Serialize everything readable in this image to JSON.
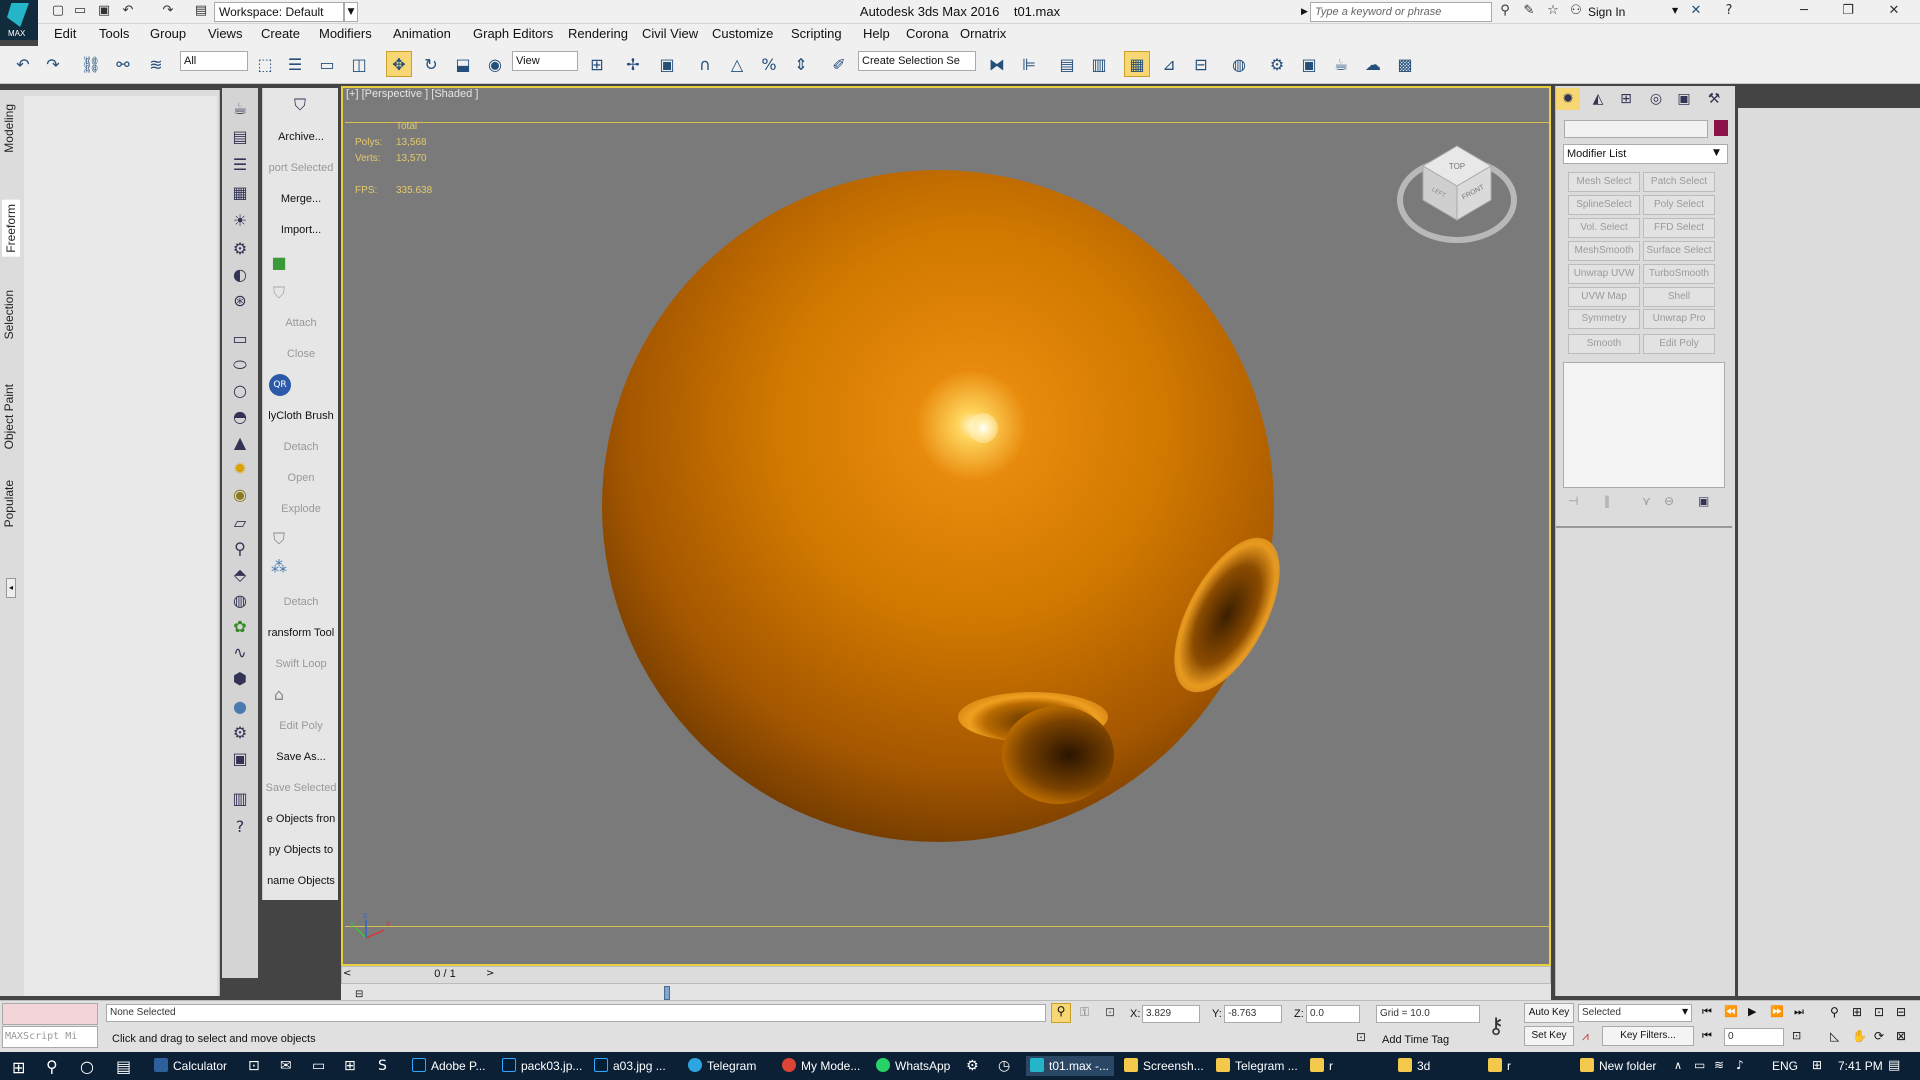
{
  "titlebar": {
    "app_title": "Autodesk 3ds Max 2016",
    "file_name": "t01.max",
    "workspace": "Workspace: Default",
    "search_placeholder": "Type a keyword or phrase",
    "sign_in": "Sign In",
    "logo_text": "MAX"
  },
  "menu": [
    "Edit",
    "Tools",
    "Group",
    "Views",
    "Create",
    "Modifiers",
    "Animation",
    "Graph Editors",
    "Rendering",
    "Civil View",
    "Customize",
    "Scripting",
    "Help",
    "Corona",
    "Ornatrix"
  ],
  "toolbar": {
    "selection_filter": "All",
    "ref_coord": "View",
    "named_selection_placeholder": "Create Selection Se"
  },
  "ribbon_tabs": [
    "Modeling",
    "Freeform",
    "Selection",
    "Object Paint",
    "Populate"
  ],
  "tool_buttons": [
    {
      "label": "Archive...",
      "enabled": true
    },
    {
      "label": "port Selected",
      "enabled": false
    },
    {
      "label": "Merge...",
      "enabled": true
    },
    {
      "label": "Import...",
      "enabled": true
    },
    {
      "label": "Attach",
      "enabled": false
    },
    {
      "label": "Close",
      "enabled": false
    },
    {
      "label": "lyCloth Brush",
      "enabled": true
    },
    {
      "label": "Detach",
      "enabled": false
    },
    {
      "label": "Open",
      "enabled": false
    },
    {
      "label": "Explode",
      "enabled": false
    },
    {
      "label": "Detach",
      "enabled": false
    },
    {
      "label": "ransform Tool",
      "enabled": true
    },
    {
      "label": "Swift Loop",
      "enabled": false
    },
    {
      "label": "Edit Poly",
      "enabled": false
    },
    {
      "label": "Save As...",
      "enabled": true
    },
    {
      "label": "Save Selected",
      "enabled": false
    },
    {
      "label": "e Objects fron",
      "enabled": true
    },
    {
      "label": "py Objects to",
      "enabled": true
    },
    {
      "label": "name Objects",
      "enabled": true
    }
  ],
  "viewport": {
    "label": "[+] [Perspective ] [Shaded ]",
    "stats_header": "Total",
    "polys_label": "Polys:",
    "polys": "13,568",
    "verts_label": "Verts:",
    "verts": "13,570",
    "fps_label": "FPS:",
    "fps": "335.638",
    "axis_x": "x",
    "axis_y": "y",
    "axis_z": "z"
  },
  "viewcube": {
    "top": "TOP",
    "front": "FRONT",
    "left": "LEFT"
  },
  "time_slider": {
    "value": "0 / 1"
  },
  "command_panel": {
    "modifier_list": "Modifier List",
    "color": "#8b1248",
    "modifiers": [
      "Mesh Select",
      "Patch Select",
      "SplineSelect",
      "Poly Select",
      "Vol. Select",
      "FFD Select",
      "MeshSmooth",
      "Surface Select",
      "Unwrap UVW",
      "TurboSmooth",
      "UVW Map",
      "Shell",
      "Symmetry",
      "Unwrap Pro",
      "Smooth",
      "Edit Poly"
    ]
  },
  "status": {
    "maxscript": "MAXScript Mi",
    "selection": "None Selected",
    "prompt": "Click and drag to select and move objects",
    "x_label": "X:",
    "x": "3.829",
    "y_label": "Y:",
    "y": "-8.763",
    "z_label": "Z:",
    "z": "0.0",
    "grid": "Grid = 10.0",
    "add_time_tag": "Add Time Tag",
    "auto_key": "Auto Key",
    "set_key": "Set Key",
    "key_mode": "Selected",
    "key_filters": "Key Filters...",
    "frame": "0"
  },
  "taskbar": {
    "apps": [
      "Calculator",
      "Adobe P...",
      "pack03.jp...",
      "a03.jpg ...",
      "Telegram",
      "My Mode...",
      "WhatsApp",
      "t01.max -...",
      "Screensh...",
      "Telegram ...",
      "r",
      "3d",
      "r",
      "New folder"
    ],
    "lang": "ENG",
    "time": "7:41 PM"
  }
}
